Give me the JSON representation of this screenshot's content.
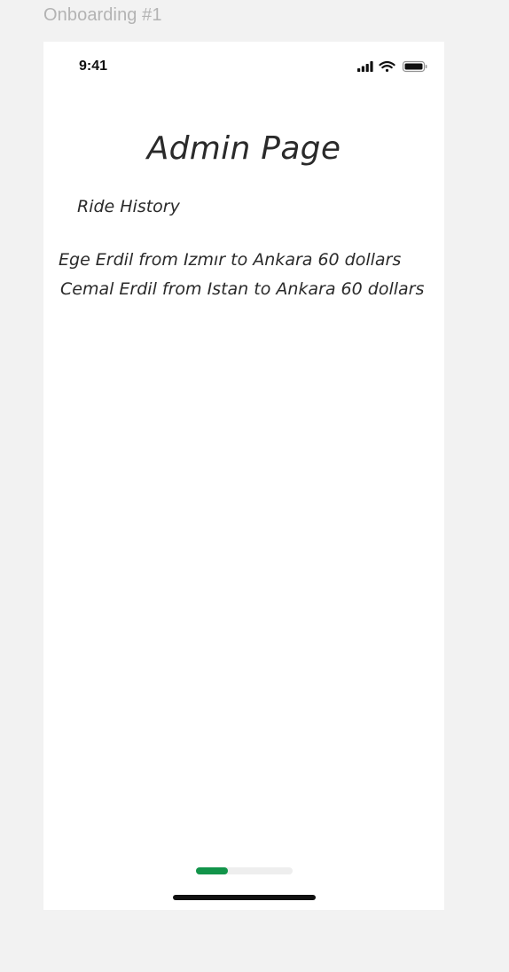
{
  "frame": {
    "label": "Onboarding #1"
  },
  "status_bar": {
    "time": "9:41",
    "icons": [
      "cellular-signal-icon",
      "wifi-icon",
      "battery-icon"
    ]
  },
  "page": {
    "title": "Admin Page",
    "section_label": "Ride History",
    "rides": [
      "Ege Erdil from Izmır to Ankara 60 dollars",
      "Cemal Erdil from Istan to Ankara 60 dollars"
    ]
  },
  "progress": {
    "fraction": 0.33,
    "color": "#12944a",
    "track_color": "#eeeeee"
  },
  "colors": {
    "canvas_background": "#f2f2f2",
    "screen_background": "#ffffff",
    "text": "#2a2a2a",
    "frame_label": "#b3b3b3"
  }
}
